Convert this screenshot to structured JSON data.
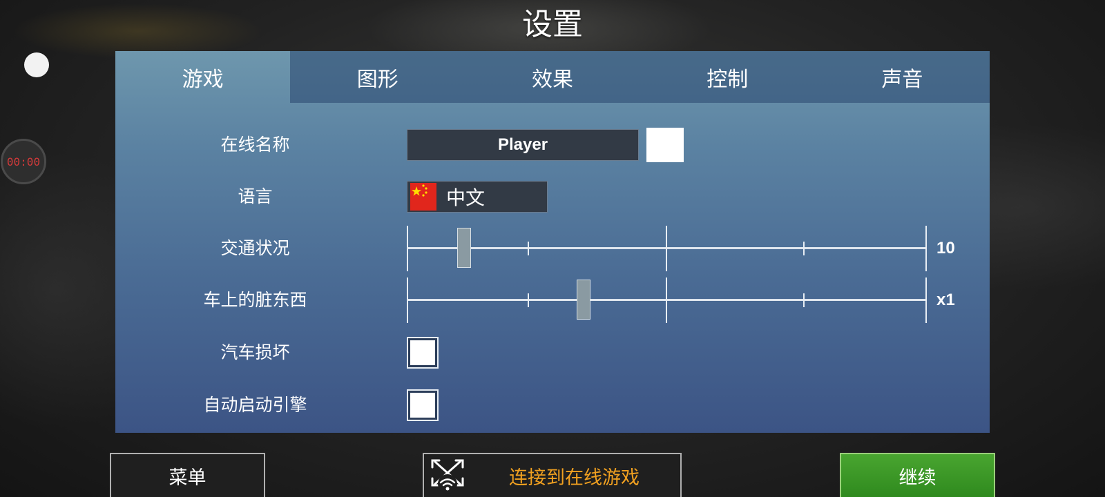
{
  "title": "设置",
  "overlay": {
    "timer": "00:00"
  },
  "tabs": [
    {
      "label": "游戏",
      "active": true
    },
    {
      "label": "图形",
      "active": false
    },
    {
      "label": "效果",
      "active": false
    },
    {
      "label": "控制",
      "active": false
    },
    {
      "label": "声音",
      "active": false
    }
  ],
  "settings": {
    "online_name": {
      "label": "在线名称",
      "value": "Player",
      "color": "#ffffff"
    },
    "language": {
      "label": "语言",
      "value": "中文",
      "flag_icon": "china-flag-icon"
    },
    "traffic": {
      "label": "交通状况",
      "value_label": "10",
      "position": 0.11
    },
    "car_dirt": {
      "label": "车上的脏东西",
      "value_label": "x1",
      "position": 0.34
    },
    "car_damage": {
      "label": "汽车损坏",
      "checked": false
    },
    "auto_start_engine": {
      "label": "自动启动引擎",
      "checked": false
    }
  },
  "buttons": {
    "menu": "菜单",
    "online": "连接到在线游戏",
    "continue": "继续"
  },
  "colors": {
    "accent_orange": "#f0a020",
    "continue_green": "#3e9a28",
    "timer_red": "#d23a3a"
  }
}
